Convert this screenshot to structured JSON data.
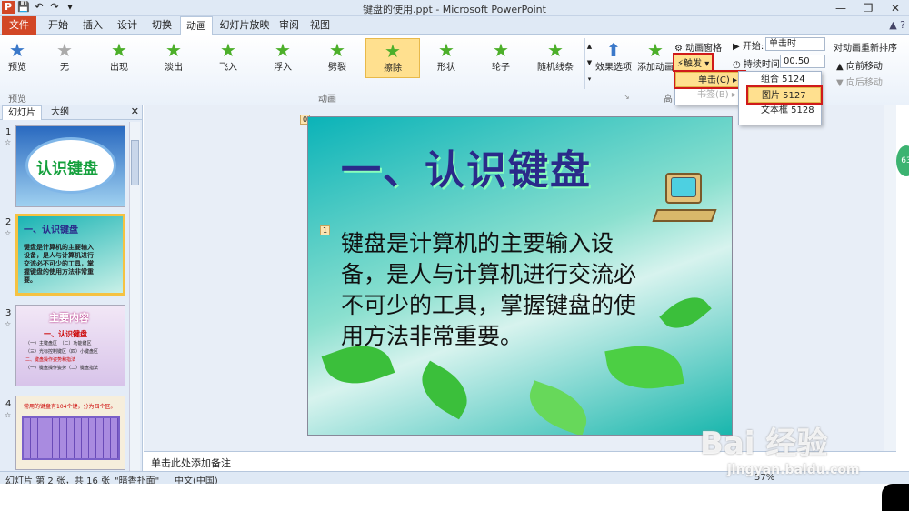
{
  "window": {
    "title": "键盘的使用.ppt - Microsoft PowerPoint"
  },
  "tabs": [
    "文件",
    "开始",
    "插入",
    "设计",
    "切换",
    "动画",
    "幻灯片放映",
    "审阅",
    "视图"
  ],
  "active_tab": "动画",
  "ribbon": {
    "preview_label": "预览",
    "preview_group": "预览",
    "animations": [
      "无",
      "出现",
      "淡出",
      "飞入",
      "浮入",
      "劈裂",
      "擦除",
      "形状",
      "轮子",
      "随机线条"
    ],
    "selected_animation": "擦除",
    "animation_group": "动画",
    "effect_options": "效果选项",
    "add_animation": "添加动画",
    "advanced_prefix": "高",
    "anim_pane": "动画窗格",
    "trigger": "触发",
    "start_label": "开始:",
    "start_value": "单击时",
    "duration_label": "持续时间:",
    "duration_value": "00.50",
    "reorder_title": "对动画重新排序",
    "move_earlier": "向前移动",
    "move_later": "向后移动"
  },
  "trigger_menu": {
    "items": [
      "单击(C)",
      "书签(B)"
    ]
  },
  "object_menu": {
    "items": [
      "组合 5124",
      "图片 5127",
      "文本框 5128"
    ],
    "selected": "图片 5127"
  },
  "left_panel": {
    "tabs": [
      "幻灯片",
      "大纲"
    ],
    "slides": [
      {
        "num": "1",
        "title": "认识键盘"
      },
      {
        "num": "2",
        "title": "一、认识键盘",
        "body": "键盘是计算机的主要输入设备，是人与计算机进行交流必不可少的工具，掌握键盘的使用方法非常重要。"
      },
      {
        "num": "3",
        "title": "主要内容",
        "sub": "一、认识键盘",
        "lines": [
          "（一）主键盘区　（二）功能键区",
          "（三）光标控制键区（四）小键盘区",
          "二、键盘操作姿势和指法",
          "（一）键盘操作姿势（二）键盘指法"
        ]
      },
      {
        "num": "4",
        "title": "常用的键盘有104个键，分为四个区。"
      }
    ]
  },
  "slide": {
    "title": "一、认识键盘",
    "body": "键盘是计算机的主要输入设备，是人与计算机进行交流必不可少的工具，掌握键盘的使用方法非常重要。",
    "marker0": "0",
    "marker1": "1"
  },
  "notes": {
    "placeholder": "单击此处添加备注"
  },
  "status": {
    "slide_info": "幻灯片 第 2 张，共 16 张",
    "theme": "\"暗香扑面\"",
    "language": "中文(中国)",
    "zoom": "57%"
  },
  "watermark": {
    "brand": "Bai 经验",
    "url": "jingyan.baidu.com"
  },
  "side_badge": "63"
}
